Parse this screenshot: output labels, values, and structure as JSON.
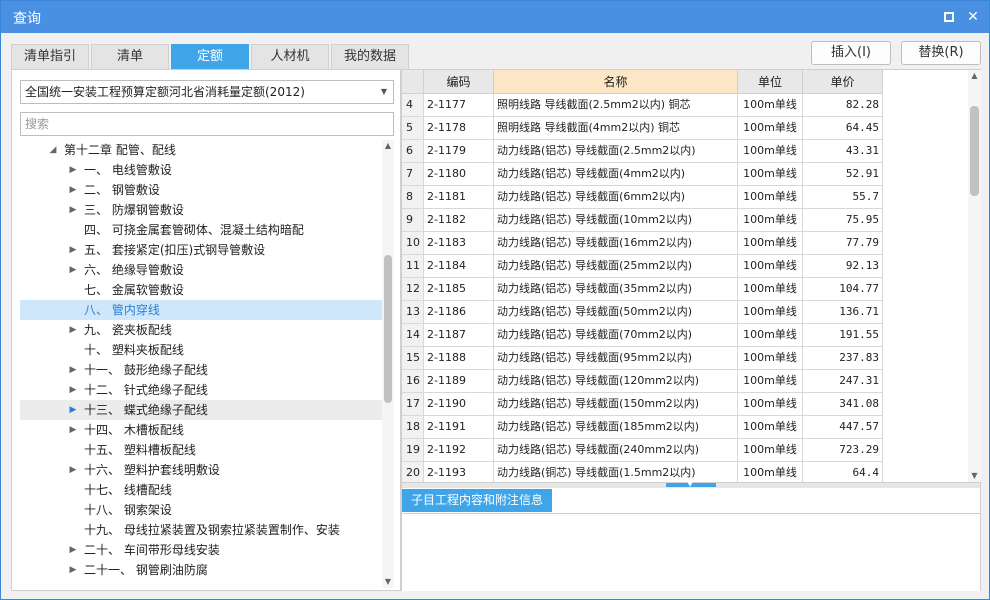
{
  "window": {
    "title": "查询"
  },
  "tabs": [
    {
      "label": "清单指引"
    },
    {
      "label": "清单"
    },
    {
      "label": "定额"
    },
    {
      "label": "人材机"
    },
    {
      "label": "我的数据"
    }
  ],
  "actions": {
    "insert_label": "插入(I)",
    "replace_label": "替换(R)"
  },
  "left_panel": {
    "library_select": "全国统一安装工程预算定额河北省消耗量定额(2012)",
    "search_placeholder": "搜索",
    "tree": [
      {
        "label": "第十二章 配管、配线",
        "expander": "collapse"
      },
      {
        "label": "一、  电线管敷设",
        "expander": "expand"
      },
      {
        "label": "二、  钢管敷设",
        "expander": "expand"
      },
      {
        "label": "三、  防爆钢管敷设",
        "expander": "expand"
      },
      {
        "label": "四、  可挠金属套管砌体、混凝土结构暗配",
        "expander": ""
      },
      {
        "label": "五、  套接紧定(扣压)式钢导管敷设",
        "expander": "expand"
      },
      {
        "label": "六、  绝缘导管敷设",
        "expander": "expand"
      },
      {
        "label": "七、  金属软管敷设",
        "expander": ""
      },
      {
        "label": "八、  管内穿线",
        "expander": "",
        "selected": true
      },
      {
        "label": "九、  瓷夹板配线",
        "expander": "expand"
      },
      {
        "label": "十、  塑料夹板配线",
        "expander": ""
      },
      {
        "label": "十一、  鼓形绝缘子配线",
        "expander": "expand"
      },
      {
        "label": "十二、  针式绝缘子配线",
        "expander": "expand"
      },
      {
        "label": "十三、  蝶式绝缘子配线",
        "expander": "expand",
        "hovered": true
      },
      {
        "label": "十四、  木槽板配线",
        "expander": "expand"
      },
      {
        "label": "十五、  塑料槽板配线",
        "expander": ""
      },
      {
        "label": "十六、  塑料护套线明敷设",
        "expander": "expand"
      },
      {
        "label": "十七、  线槽配线",
        "expander": ""
      },
      {
        "label": "十八、  钢索架设",
        "expander": ""
      },
      {
        "label": "十九、  母线拉紧装置及钢索拉紧装置制作、安装",
        "expander": ""
      },
      {
        "label": "二十、  车间带形母线安装",
        "expander": "expand"
      },
      {
        "label": "二十一、  钢管刷油防腐",
        "expander": "expand"
      }
    ]
  },
  "table": {
    "columns": [
      "编码",
      "名称",
      "单位",
      "单价"
    ],
    "rows": [
      {
        "idx": "4",
        "code": "2-1177",
        "name": "照明线路 导线截面(2.5mm2以内) 铜芯",
        "unit": "100m单线",
        "price": "82.28"
      },
      {
        "idx": "5",
        "code": "2-1178",
        "name": "照明线路 导线截面(4mm2以内) 铜芯",
        "unit": "100m单线",
        "price": "64.45"
      },
      {
        "idx": "6",
        "code": "2-1179",
        "name": "动力线路(铝芯) 导线截面(2.5mm2以内)",
        "unit": "100m单线",
        "price": "43.31"
      },
      {
        "idx": "7",
        "code": "2-1180",
        "name": "动力线路(铝芯) 导线截面(4mm2以内)",
        "unit": "100m单线",
        "price": "52.91"
      },
      {
        "idx": "8",
        "code": "2-1181",
        "name": "动力线路(铝芯) 导线截面(6mm2以内)",
        "unit": "100m单线",
        "price": "55.7"
      },
      {
        "idx": "9",
        "code": "2-1182",
        "name": "动力线路(铝芯) 导线截面(10mm2以内)",
        "unit": "100m单线",
        "price": "75.95"
      },
      {
        "idx": "10",
        "code": "2-1183",
        "name": "动力线路(铝芯) 导线截面(16mm2以内)",
        "unit": "100m单线",
        "price": "77.79"
      },
      {
        "idx": "11",
        "code": "2-1184",
        "name": "动力线路(铝芯) 导线截面(25mm2以内)",
        "unit": "100m单线",
        "price": "92.13"
      },
      {
        "idx": "12",
        "code": "2-1185",
        "name": "动力线路(铝芯) 导线截面(35mm2以内)",
        "unit": "100m单线",
        "price": "104.77"
      },
      {
        "idx": "13",
        "code": "2-1186",
        "name": "动力线路(铝芯) 导线截面(50mm2以内)",
        "unit": "100m单线",
        "price": "136.71"
      },
      {
        "idx": "14",
        "code": "2-1187",
        "name": "动力线路(铝芯) 导线截面(70mm2以内)",
        "unit": "100m单线",
        "price": "191.55"
      },
      {
        "idx": "15",
        "code": "2-1188",
        "name": "动力线路(铝芯) 导线截面(95mm2以内)",
        "unit": "100m单线",
        "price": "237.83"
      },
      {
        "idx": "16",
        "code": "2-1189",
        "name": "动力线路(铝芯) 导线截面(120mm2以内)",
        "unit": "100m单线",
        "price": "247.31"
      },
      {
        "idx": "17",
        "code": "2-1190",
        "name": "动力线路(铝芯) 导线截面(150mm2以内)",
        "unit": "100m单线",
        "price": "341.08"
      },
      {
        "idx": "18",
        "code": "2-1191",
        "name": "动力线路(铝芯) 导线截面(185mm2以内)",
        "unit": "100m单线",
        "price": "447.57"
      },
      {
        "idx": "19",
        "code": "2-1192",
        "name": "动力线路(铝芯) 导线截面(240mm2以内)",
        "unit": "100m单线",
        "price": "723.29"
      },
      {
        "idx": "20",
        "code": "2-1193",
        "name": "动力线路(铜芯) 导线截面(1.5mm2以内)",
        "unit": "100m单线",
        "price": "64.4"
      }
    ]
  },
  "info_panel": {
    "tab_label": "子目工程内容和附注信息"
  },
  "colors": {
    "titlebar": "#4a90e2",
    "accent": "#3fa4e8",
    "selected_row": "#cfe7fb",
    "header_highlight": "#fde6c6"
  }
}
